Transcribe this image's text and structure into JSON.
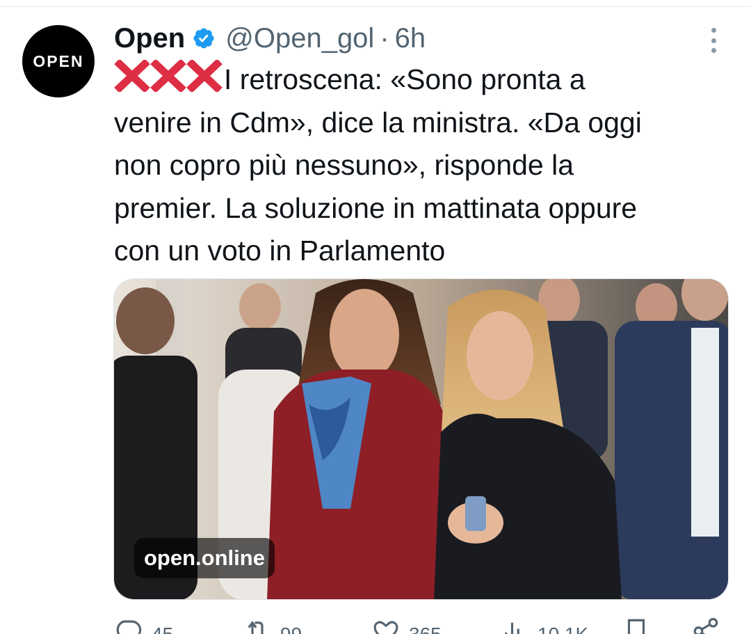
{
  "tweet": {
    "avatar_text": "OPEN",
    "display_name": "Open",
    "handle": "@Open_gol",
    "separator": "·",
    "time": "6h",
    "emoji": "❌❌❌",
    "text_lines": [
      "I retroscena: «Sono pronta a",
      "venire in Cdm», dice la ministra. «Da oggi",
      "non copro più nessuno», risponde la",
      "premier. La soluzione in mattinata oppure",
      "con un voto in Parlamento"
    ],
    "link_card": {
      "source": "open.online"
    },
    "actions": {
      "replies": "45",
      "retweets": "99",
      "likes": "365",
      "views": "10.1K"
    }
  },
  "icons": {
    "verified": "verified-badge-icon",
    "more": "more-options-icon",
    "reply": "reply-icon",
    "retweet": "retweet-icon",
    "like": "like-icon",
    "views": "views-icon",
    "bookmark": "bookmark-icon",
    "share": "share-icon"
  },
  "colors": {
    "verified_blue": "#1d9bf0",
    "text_primary": "#0f1419",
    "text_secondary": "#536471",
    "x_mark_red": "#dd2e44"
  }
}
